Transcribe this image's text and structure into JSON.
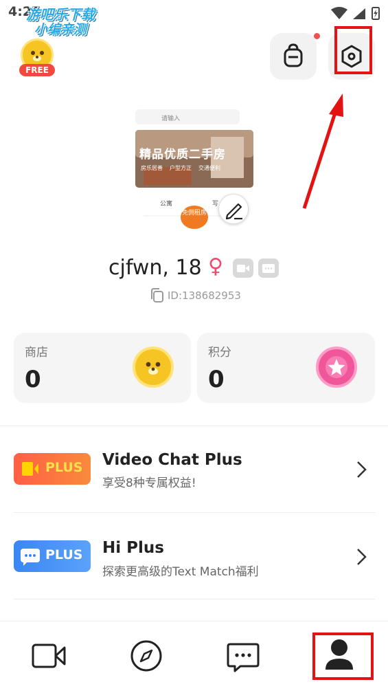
{
  "status": {
    "time": "4:27",
    "watermark_line1": "游吧乐下载",
    "watermark_line2": "小编亲测"
  },
  "header": {
    "free_badge_label": "FREE",
    "backpack_icon": "backpack-icon",
    "settings_icon": "hexagon-settings-icon",
    "highlight_color": "#e41313"
  },
  "profile": {
    "cover_banner_text": "精品优质二手房",
    "cover_search_placeholder": "请输入",
    "cover_tags": [
      "房乐居善",
      "户型方正",
      "交通便利"
    ],
    "cover_item1": "公寓",
    "cover_item2": "写",
    "cover_badge": "免佣租房",
    "name": "cjfwn, 18",
    "gender_symbol": "♀",
    "id_text": "ID:138682953"
  },
  "stats": {
    "shop_label": "商店",
    "shop_value": "0",
    "points_label": "积分",
    "points_value": "0"
  },
  "plus": [
    {
      "badge": "PLUS",
      "title": "Video Chat Plus",
      "subtitle": "享受8种专属权益!",
      "color": "#f5683b"
    },
    {
      "badge": "PLUS",
      "title": "Hi Plus",
      "subtitle": "探索更高级的Text Match福利",
      "color": "#3d84f5"
    }
  ],
  "nav": {
    "items": [
      "video-camera-icon",
      "compass-icon",
      "chat-icon",
      "profile-icon"
    ],
    "active": "profile-icon"
  }
}
